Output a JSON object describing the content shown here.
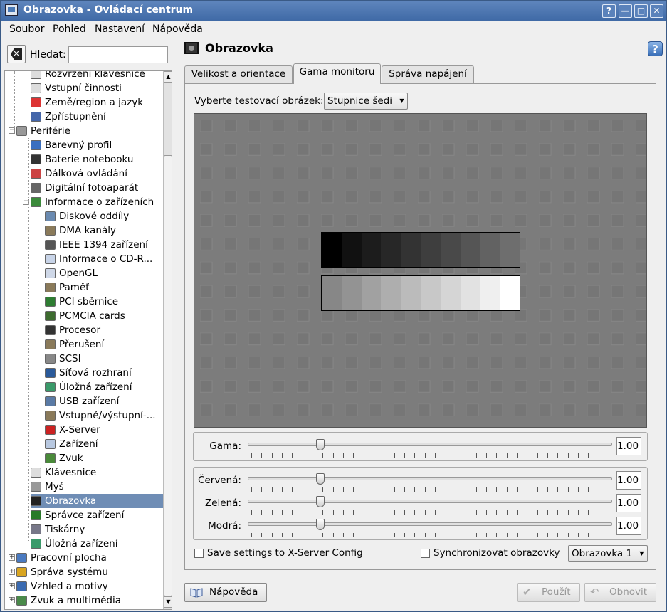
{
  "window": {
    "title": "Obrazovka - Ovládací centrum"
  },
  "titlebar_buttons": {
    "help": "?",
    "minimize": "—",
    "maximize": "□",
    "close": "✕"
  },
  "menu": [
    "Soubor",
    "Pohled",
    "Nastavení",
    "Nápověda"
  ],
  "search": {
    "label": "Hledat:",
    "value": ""
  },
  "tree": {
    "items": [
      {
        "label": "Rozvržení klávesnice",
        "icon": "keyboard-icon",
        "level": 1
      },
      {
        "label": "Vstupní činnosti",
        "icon": "keyboard-icon",
        "level": 1
      },
      {
        "label": "Země/region a jazyk",
        "icon": "flag-icon",
        "level": 1
      },
      {
        "label": "Zpřístupnění",
        "icon": "accessibility-icon",
        "level": 1
      },
      {
        "label": "Periférie",
        "icon": "mouse-icon",
        "level": 0,
        "expander": "−"
      },
      {
        "label": "Barevný profil",
        "icon": "color-profile-icon",
        "level": 1
      },
      {
        "label": "Baterie notebooku",
        "icon": "battery-icon",
        "level": 1
      },
      {
        "label": "Dálková ovládání",
        "icon": "remote-icon",
        "level": 1
      },
      {
        "label": "Digitální fotoaparát",
        "icon": "camera-icon",
        "level": 1
      },
      {
        "label": "Informace o zařízeních",
        "icon": "device-info-icon",
        "level": 1,
        "expander": "−"
      },
      {
        "label": "Diskové oddíly",
        "icon": "disk-icon",
        "level": 2
      },
      {
        "label": "DMA kanály",
        "icon": "chip-icon",
        "level": 2
      },
      {
        "label": "IEEE 1394 zařízení",
        "icon": "firewire-icon",
        "level": 2
      },
      {
        "label": "Informace o CD-R...",
        "icon": "cd-icon",
        "level": 2
      },
      {
        "label": "OpenGL",
        "icon": "opengl-icon",
        "level": 2
      },
      {
        "label": "Paměť",
        "icon": "chip-icon",
        "level": 2
      },
      {
        "label": "PCI sběrnice",
        "icon": "pci-card-icon",
        "level": 2
      },
      {
        "label": "PCMCIA cards",
        "icon": "pcmcia-icon",
        "level": 2
      },
      {
        "label": "Procesor",
        "icon": "cpu-icon",
        "level": 2
      },
      {
        "label": "Přerušení",
        "icon": "chip-icon",
        "level": 2
      },
      {
        "label": "SCSI",
        "icon": "scsi-icon",
        "level": 2
      },
      {
        "label": "Síťová rozhraní",
        "icon": "network-icon",
        "level": 2
      },
      {
        "label": "Úložná zařízení",
        "icon": "storage-icon",
        "level": 2
      },
      {
        "label": "USB zařízení",
        "icon": "usb-icon",
        "level": 2
      },
      {
        "label": "Vstupně/výstupní-...",
        "icon": "chip-icon",
        "level": 2
      },
      {
        "label": "X-Server",
        "icon": "x-server-icon",
        "level": 2
      },
      {
        "label": "Zařízení",
        "icon": "device-icon",
        "level": 2
      },
      {
        "label": "Zvuk",
        "icon": "sound-icon",
        "level": 2
      },
      {
        "label": "Klávesnice",
        "icon": "keyboard-icon",
        "level": 1
      },
      {
        "label": "Myš",
        "icon": "mouse-icon",
        "level": 1
      },
      {
        "label": "Obrazovka",
        "icon": "display-icon",
        "level": 1,
        "selected": true
      },
      {
        "label": "Správce zařízení",
        "icon": "device-manager-icon",
        "level": 1
      },
      {
        "label": "Tiskárny",
        "icon": "printer-icon",
        "level": 1
      },
      {
        "label": "Úložná zařízení",
        "icon": "storage-icon",
        "level": 1
      },
      {
        "label": "Pracovní plocha",
        "icon": "desktop-icon",
        "level": 0,
        "expander": "+"
      },
      {
        "label": "Správa systému",
        "icon": "system-admin-icon",
        "level": 0,
        "expander": "+"
      },
      {
        "label": "Vzhled a motivy",
        "icon": "appearance-icon",
        "level": 0,
        "expander": "+"
      },
      {
        "label": "Zvuk a multimédia",
        "icon": "multimedia-icon",
        "level": 0,
        "expander": "+"
      }
    ]
  },
  "panel": {
    "title": "Obrazovka"
  },
  "tabs": [
    "Velikost a orientace",
    "Gama monitoru",
    "Správa napájení"
  ],
  "active_tab": "Gama monitoru",
  "test_image": {
    "label": "Vyberte testovací obrázek:",
    "selected": "Stupnice šedi"
  },
  "gamma": {
    "label": "Gama:",
    "value": "1.00"
  },
  "rgb": [
    {
      "label": "Červená:",
      "value": "1.00"
    },
    {
      "label": "Zelená:",
      "value": "1.00"
    },
    {
      "label": "Modrá:",
      "value": "1.00"
    }
  ],
  "save_settings": {
    "label": "Save settings to X-Server Config",
    "checked": false
  },
  "sync_screens": {
    "label": "Synchronizovat obrazovky",
    "checked": false
  },
  "screen_select": {
    "selected": "Obrazovka 1"
  },
  "buttons": {
    "help": "Nápověda",
    "apply": "Použít",
    "reset": "Obnovit"
  },
  "colors": {
    "titlebar": "#4f78b2",
    "selection": "#6f8db5",
    "test_bg": "#7c7c7c"
  },
  "gray_scale": {
    "dark": [
      "#000000",
      "#111111",
      "#1c1c1c",
      "#272727",
      "#333333",
      "#3e3e3e",
      "#494949",
      "#555555",
      "#626262",
      "#6e6e6e"
    ],
    "light": [
      "#878787",
      "#939393",
      "#a1a1a1",
      "#aeaeae",
      "#bbbbbb",
      "#c8c8c8",
      "#d5d5d5",
      "#e2e2e2",
      "#efefef",
      "#ffffff"
    ]
  }
}
